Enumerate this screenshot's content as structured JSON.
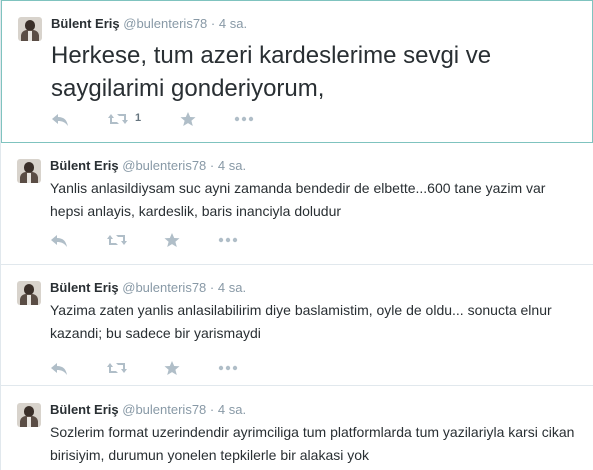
{
  "tweets": [
    {
      "fullname": "Bülent Eriş",
      "username": "@bulenteris78",
      "dot": "·",
      "time": "4 sa.",
      "text": "Herkese, tum azeri kardeslerime sevgi ve saygilarimi gonderiyorum,",
      "retweet_count": "1",
      "icons": [
        "reply-icon",
        "retweet-icon",
        "favorite-icon",
        "more-icon"
      ]
    },
    {
      "fullname": "Bülent Eriş",
      "username": "@bulenteris78",
      "dot": "·",
      "time": "4 sa.",
      "text": "Yanlis anlasildiysam suc ayni zamanda  bendedir de elbette...600 tane yazim var hepsi anlayis, kardeslik, baris inanciyla doludur",
      "retweet_count": "",
      "icons": [
        "reply-icon",
        "retweet-icon",
        "favorite-icon",
        "more-icon"
      ]
    },
    {
      "fullname": "Bülent Eriş",
      "username": "@bulenteris78",
      "dot": "·",
      "time": "4 sa.",
      "text": "Yazima zaten yanlis anlasilabilirim diye baslamistim, oyle de oldu... sonucta elnur kazandi; bu sadece bir yarismaydi",
      "retweet_count": "",
      "icons": [
        "reply-icon",
        "retweet-icon",
        "favorite-icon",
        "more-icon"
      ]
    },
    {
      "fullname": "Bülent Eriş",
      "username": "@bulenteris78",
      "dot": "·",
      "time": "4 sa.",
      "text": "Sozlerim format uzerindendir ayrimciliga tum platformlarda tum yazilariyla karsi cikan birisiyim, durumun yonelen tepkilerle bir alakasi yok",
      "retweet_count": "",
      "icons": [
        "reply-icon",
        "retweet-icon",
        "favorite-icon",
        "more-icon"
      ]
    }
  ],
  "colors": {
    "name": "#292f33",
    "meta": "#8899a6",
    "icon": "#b0bec8",
    "border": "#e1e8ed",
    "highlight_border": "#7fc3bf"
  }
}
